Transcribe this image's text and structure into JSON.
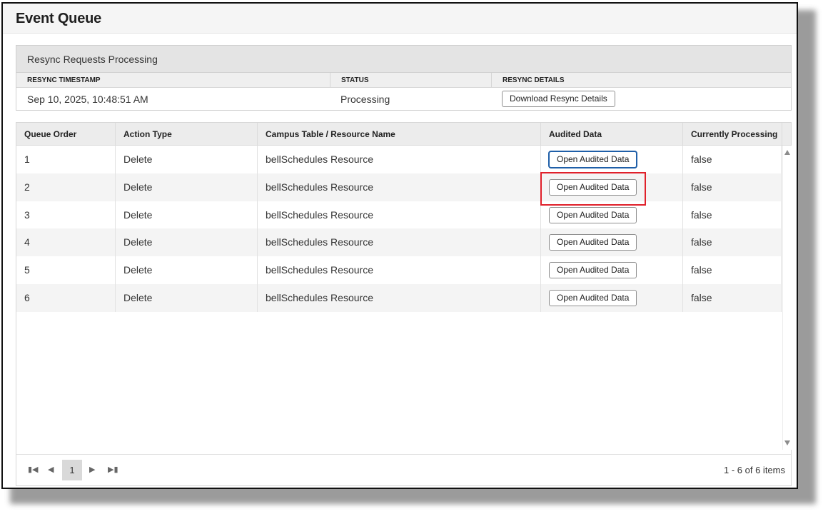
{
  "page": {
    "title": "Event Queue"
  },
  "resync": {
    "heading": "Resync Requests Processing",
    "columns": [
      "RESYNC TIMESTAMP",
      "STATUS",
      "RESYNC DETAILS"
    ],
    "row": {
      "timestamp": "Sep 10, 2025, 10:48:51 AM",
      "status": "Processing",
      "button": "Download Resync Details"
    }
  },
  "grid": {
    "columns": [
      "Queue Order",
      "Action Type",
      "Campus Table / Resource Name",
      "Audited Data",
      "Currently Processing"
    ],
    "rows": [
      {
        "order": "1",
        "action": "Delete",
        "resource": "bellSchedules Resource",
        "audited": "Open Audited Data",
        "processing": "false"
      },
      {
        "order": "2",
        "action": "Delete",
        "resource": "bellSchedules Resource",
        "audited": "Open Audited Data",
        "processing": "false"
      },
      {
        "order": "3",
        "action": "Delete",
        "resource": "bellSchedules Resource",
        "audited": "Open Audited Data",
        "processing": "false"
      },
      {
        "order": "4",
        "action": "Delete",
        "resource": "bellSchedules Resource",
        "audited": "Open Audited Data",
        "processing": "false"
      },
      {
        "order": "5",
        "action": "Delete",
        "resource": "bellSchedules Resource",
        "audited": "Open Audited Data",
        "processing": "false"
      },
      {
        "order": "6",
        "action": "Delete",
        "resource": "bellSchedules Resource",
        "audited": "Open Audited Data",
        "processing": "false"
      }
    ],
    "highlighted_row": 1
  },
  "pager": {
    "first_icon": "first-page-icon",
    "prev_icon": "prev-page-icon",
    "next_icon": "next-page-icon",
    "last_icon": "last-page-icon",
    "current_page": "1",
    "info": "1 - 6 of 6 items"
  },
  "colors": {
    "highlight": "#e0202a",
    "focus": "#1f5fa8",
    "header_bg": "#ececec",
    "alt_row": "#f4f4f4"
  }
}
